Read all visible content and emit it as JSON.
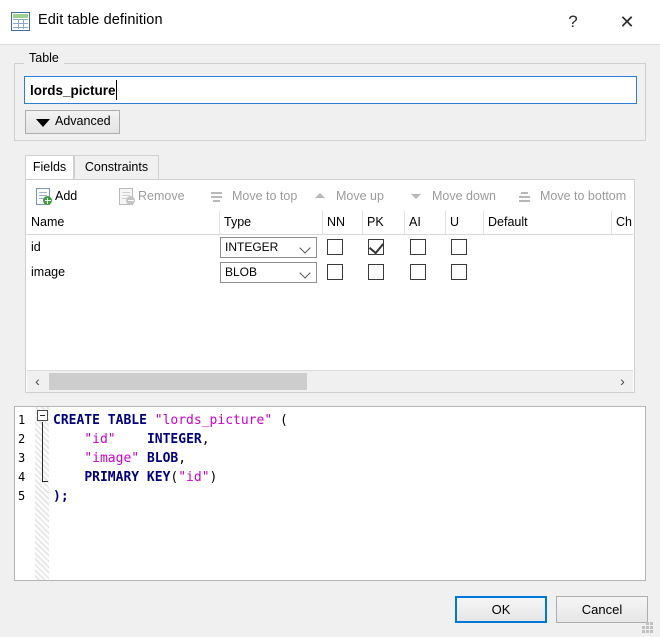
{
  "window": {
    "title": "Edit table definition",
    "icon": "table-grid-icon",
    "help_label": "?",
    "close_label": "✕"
  },
  "table_group": {
    "legend": "Table",
    "name_value": "lords_picture",
    "advanced_label": "Advanced"
  },
  "tabs": [
    {
      "label": "Fields",
      "active": true
    },
    {
      "label": "Constraints",
      "active": false
    }
  ],
  "toolbar": [
    {
      "label": "Add",
      "icon": "add-document-icon",
      "enabled": true
    },
    {
      "label": "Remove",
      "icon": "remove-document-icon",
      "enabled": false
    },
    {
      "label": "Move to top",
      "icon": "move-to-top-icon",
      "enabled": false
    },
    {
      "label": "Move up",
      "icon": "move-up-icon",
      "enabled": false
    },
    {
      "label": "Move down",
      "icon": "move-down-icon",
      "enabled": false
    },
    {
      "label": "Move to bottom",
      "icon": "move-to-bottom-icon",
      "enabled": false
    }
  ],
  "grid": {
    "columns": [
      "Name",
      "Type",
      "NN",
      "PK",
      "AI",
      "U",
      "Default",
      "Ch"
    ],
    "rows": [
      {
        "name": "id",
        "type": "INTEGER",
        "nn": false,
        "pk": true,
        "ai": false,
        "u": false,
        "default": "",
        "check": ""
      },
      {
        "name": "image",
        "type": "BLOB",
        "nn": false,
        "pk": false,
        "ai": false,
        "u": false,
        "default": "",
        "check": ""
      }
    ]
  },
  "sql": {
    "lines": [
      {
        "no": "1",
        "text": "CREATE TABLE \"lords_picture\" ("
      },
      {
        "no": "2",
        "text": "    \"id\"    INTEGER,"
      },
      {
        "no": "3",
        "text": "    \"image\" BLOB,"
      },
      {
        "no": "4",
        "text": "    PRIMARY KEY(\"id\")"
      },
      {
        "no": "5",
        "text": ");"
      }
    ]
  },
  "footer": {
    "ok_label": "OK",
    "cancel_label": "Cancel"
  },
  "colors": {
    "accent": "#0078d7",
    "input_focus_border": "#2c7fd4",
    "sql_keyword": "#00007f",
    "sql_string": "#cc00cc"
  }
}
